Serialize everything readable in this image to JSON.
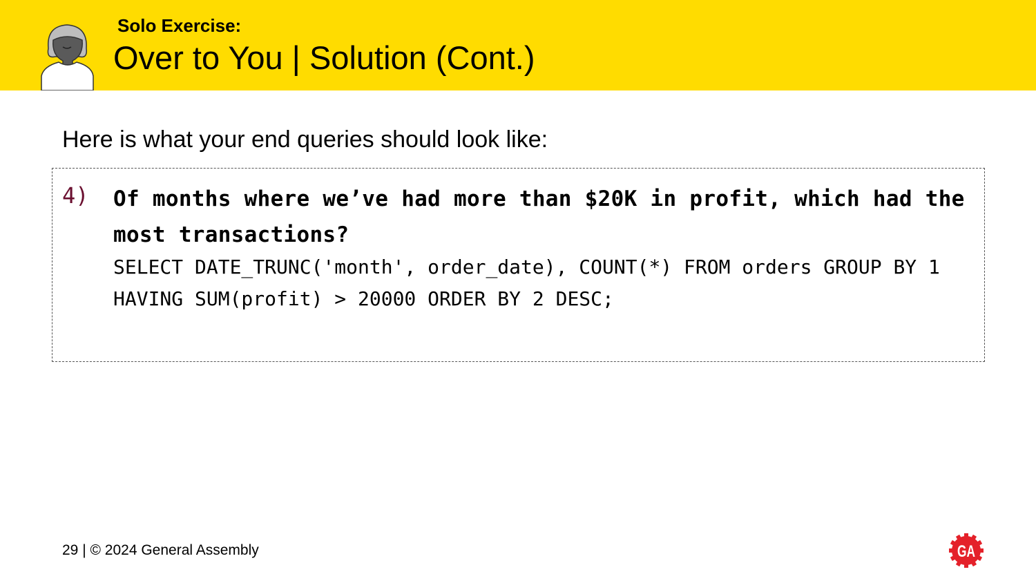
{
  "header": {
    "kicker": "Solo Exercise:",
    "title": "Over to You | Solution (Cont.)"
  },
  "intro": "Here is what your end queries should look like:",
  "question": {
    "number": "4)",
    "text": "Of months where we’ve had more than $20K in profit, which had the most transactions?",
    "code": "SELECT DATE_TRUNC('month', order_date), COUNT(*) FROM orders GROUP BY 1\nHAVING SUM(profit) > 20000 ORDER BY 2 DESC;"
  },
  "footer": {
    "text": "29 | © 2024 General Assembly"
  },
  "logo": {
    "text": "GA"
  },
  "colors": {
    "header_bg": "#FFDC00",
    "number": "#6b1030",
    "logo": "#E4212A"
  }
}
